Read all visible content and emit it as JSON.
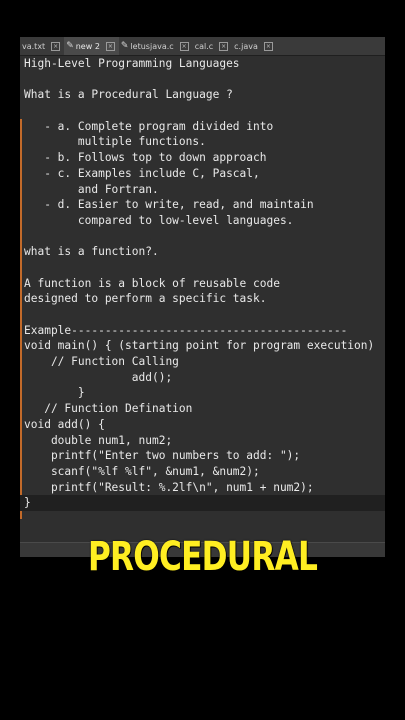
{
  "tabs": [
    {
      "label": "va.txt",
      "active": false,
      "icon": ""
    },
    {
      "label": "new 2",
      "active": true,
      "icon": "pencil-icon"
    },
    {
      "label": "letusjava.c",
      "active": false,
      "icon": "pencil-icon"
    },
    {
      "label": "cal.c",
      "active": false,
      "icon": ""
    },
    {
      "label": "c.java",
      "active": false,
      "icon": ""
    }
  ],
  "editor": {
    "lines": [
      "High-Level Programming Languages",
      "",
      "What is a Procedural Language ?",
      "",
      "   - a. Complete program divided into",
      "        multiple functions.",
      "   - b. Follows top to down approach",
      "   - c. Examples include C, Pascal,",
      "        and Fortran.",
      "   - d. Easier to write, read, and maintain",
      "        compared to low-level languages.",
      "",
      "what is a function?.",
      "",
      "A function is a block of reusable code",
      "designed to perform a specific task.",
      "",
      "Example-----------------------------------------",
      "void main() { (starting point for program execution)",
      "    // Function Calling",
      "                add();",
      "        }",
      "   // Function Defination",
      "void add() {",
      "    double num1, num2;",
      "    printf(\"Enter two numbers to add: \");",
      "    scanf(\"%lf %lf\", &num1, &num2);",
      "    printf(\"Result: %.2lf\\n\", num1 + num2);",
      "}"
    ],
    "current_line": 28
  },
  "caption": "PROCEDURAL",
  "colors": {
    "caption": "#ffee22",
    "accent_bar": "#c26a2a",
    "editor_bg": "#2f2f2f"
  }
}
